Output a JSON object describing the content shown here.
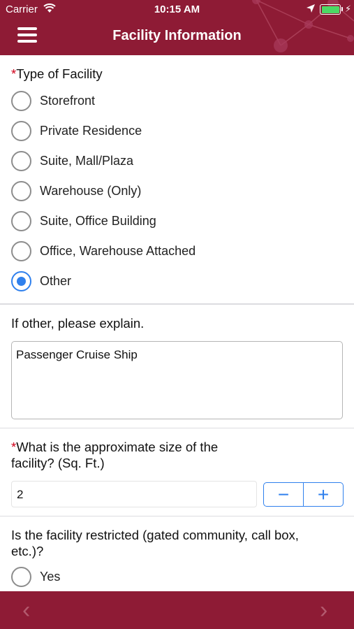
{
  "status_bar": {
    "carrier": "Carrier",
    "time": "10:15 AM",
    "battery_color": "#4cd964"
  },
  "header": {
    "title": "Facility Information",
    "menu_icon": "hamburger-menu-icon",
    "background": "#8e1b35"
  },
  "facility_type": {
    "required_marker": "*",
    "label": "Type of Facility",
    "options": [
      {
        "label": "Storefront",
        "selected": false
      },
      {
        "label": "Private Residence",
        "selected": false
      },
      {
        "label": "Suite, Mall/Plaza",
        "selected": false
      },
      {
        "label": "Warehouse (Only)",
        "selected": false
      },
      {
        "label": "Suite, Office Building",
        "selected": false
      },
      {
        "label": "Office, Warehouse Attached",
        "selected": false
      },
      {
        "label": "Other",
        "selected": true
      }
    ]
  },
  "other_explain": {
    "label": "If other, please explain.",
    "value": "Passenger Cruise Ship"
  },
  "facility_size": {
    "required_marker": "*",
    "label": "What is the approximate size of the facility? (Sq. Ft.)",
    "value": "2",
    "decrement": "−",
    "increment": "+"
  },
  "restricted": {
    "label": "Is the facility restricted (gated community, call box, etc.)?",
    "options": [
      {
        "label": "Yes",
        "selected": false
      }
    ]
  },
  "footer": {
    "prev": "‹",
    "next": "›"
  },
  "accent_color": "#2f80ed"
}
